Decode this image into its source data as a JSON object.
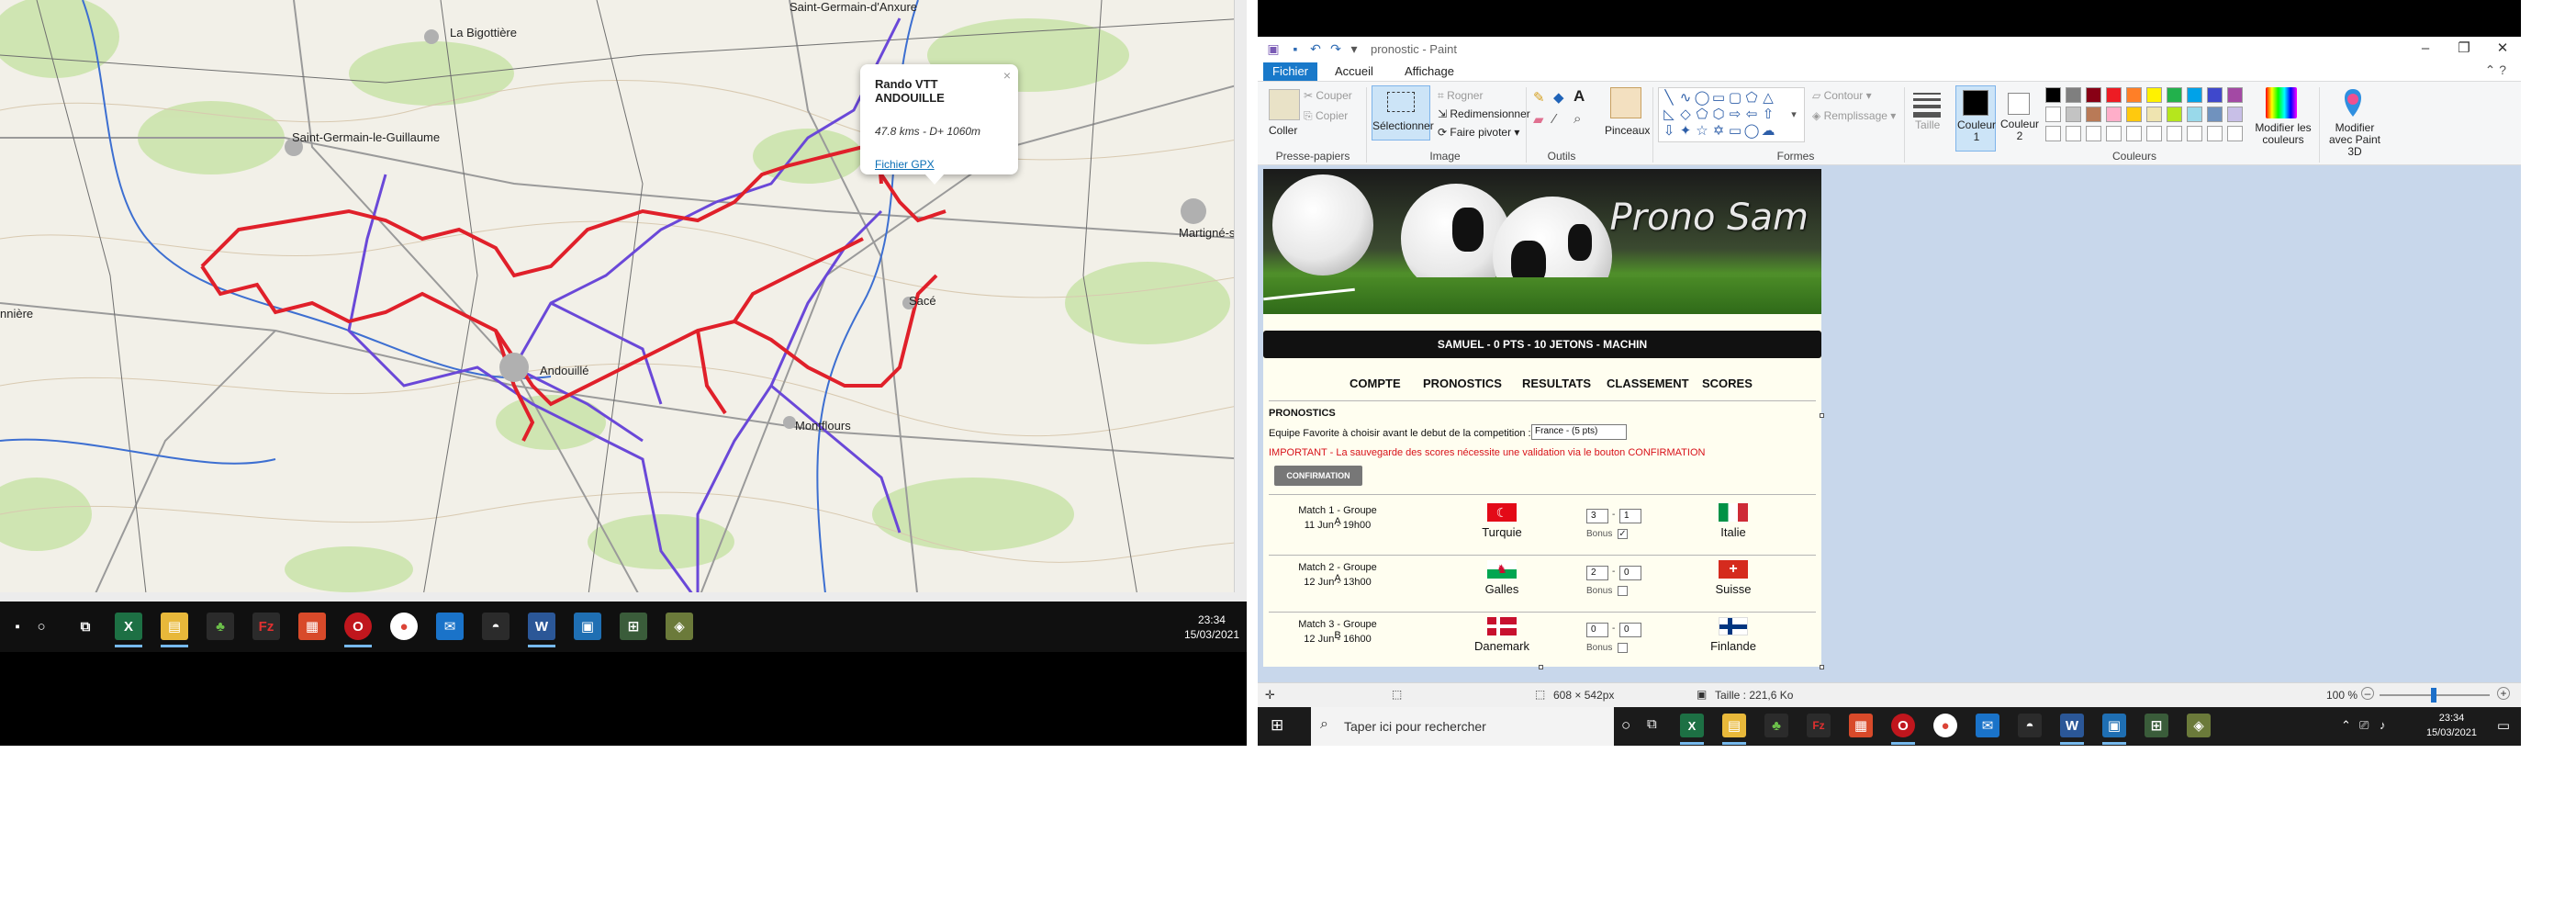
{
  "map": {
    "places": [
      "Saint-Germain-d'Anxure",
      "La Bigottière",
      "Saint-Germain-le-Guillaume",
      "Martigné-su",
      "nnière",
      "Sacé",
      "Andouillé",
      "Montflours"
    ],
    "popup": {
      "title": "Rando VTT ANDOUILLE",
      "info": "47.8 kms - D+ 1060m",
      "link": "Fichier GPX"
    }
  },
  "left_taskbar": {
    "time": "23:34",
    "date": "15/03/2021"
  },
  "paint": {
    "title": "pronostic - Paint",
    "menu": {
      "fichier": "Fichier",
      "accueil": "Accueil",
      "affichage": "Affichage"
    },
    "ribbon": {
      "coller": "Coller",
      "couper": "Couper",
      "copier": "Copier",
      "presse_papiers": "Presse-papiers",
      "selectionner": "Sélectionner",
      "rogner": "Rogner",
      "redimensionner": "Redimensionner",
      "faire_pivoter": "Faire pivoter",
      "image": "Image",
      "outils": "Outils",
      "pinceaux": "Pinceaux",
      "formes": "Formes",
      "contour": "Contour",
      "remplissage": "Remplissage",
      "taille": "Taille",
      "couleur1": "Couleur 1",
      "couleur2": "Couleur 2",
      "couleurs": "Couleurs",
      "modifier_couleurs": "Modifier les couleurs",
      "paint3d": "Modifier avec Paint 3D"
    },
    "palette_row1": [
      "#000000",
      "#7f7f7f",
      "#880015",
      "#ed1c24",
      "#ff7f27",
      "#fff200",
      "#22b14c",
      "#00a2e8",
      "#3f48cc",
      "#a349a4"
    ],
    "palette_row2": [
      "#ffffff",
      "#c3c3c3",
      "#b97a57",
      "#ffaec9",
      "#ffc90e",
      "#efe4b0",
      "#b5e61d",
      "#99d9ea",
      "#7092be",
      "#c8bfe7"
    ],
    "canvas": {
      "banner_title": "Prono Sam",
      "status_strip": "SAMUEL - 0 PTS - 10 JETONS - MACHIN",
      "nav": [
        "COMPTE",
        "PRONOSTICS",
        "RESULTATS",
        "CLASSEMENT",
        "SCORES"
      ],
      "heading": "PRONOSTICS",
      "fav_label": "Equipe Favorite à choisir avant le debut de la competition :",
      "fav_value": "France - (5 pts)",
      "important": "IMPORTANT - La sauvegarde des scores nécessite une validation via le bouton CONFIRMATION",
      "confirm": "CONFIRMATION",
      "bonus_label": "Bonus",
      "matches": [
        {
          "title": "Match 1 - Groupe A",
          "date": "11 Jun - 19h00",
          "home": "Turquie",
          "away": "Italie",
          "score_home": "3",
          "score_away": "1",
          "bonus": "✓"
        },
        {
          "title": "Match 2 - Groupe A",
          "date": "12 Jun - 13h00",
          "home": "Galles",
          "away": "Suisse",
          "score_home": "2",
          "score_away": "0",
          "bonus": ""
        },
        {
          "title": "Match 3 - Groupe B",
          "date": "12 Jun - 16h00",
          "home": "Danemark",
          "away": "Finlande",
          "score_home": "0",
          "score_away": "0",
          "bonus": ""
        }
      ]
    },
    "statusbar": {
      "dimensions": "608 × 542px",
      "size": "Taille : 221,6 Ko",
      "zoom": "100 %"
    }
  },
  "right_taskbar": {
    "search_placeholder": "Taper ici pour rechercher",
    "time": "23:34",
    "date": "15/03/2021"
  }
}
